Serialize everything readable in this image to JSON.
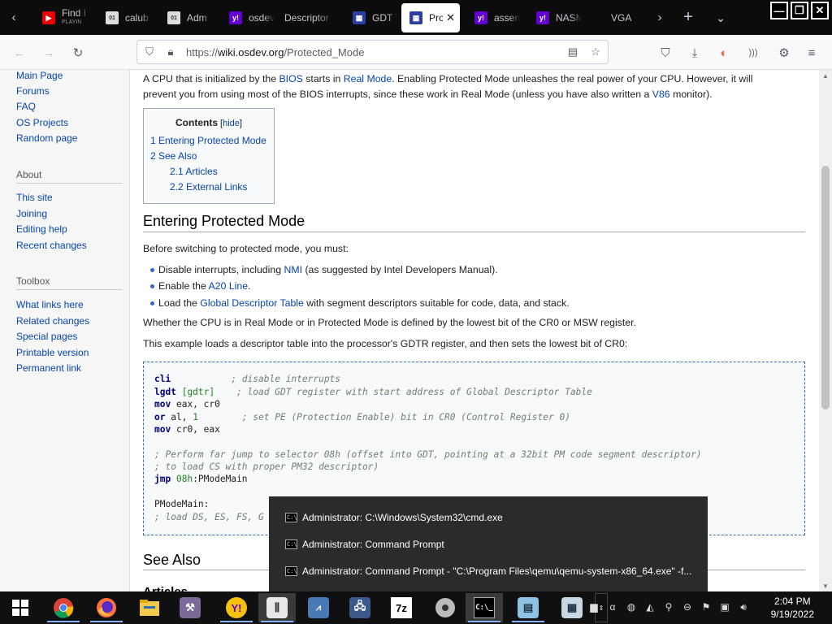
{
  "tabs": [
    {
      "title": "Find I",
      "subtitle": "PLAYIN",
      "icon": "youtube-icon"
    },
    {
      "title": "calub",
      "icon": "text-file-icon"
    },
    {
      "title": "Adm",
      "icon": "text-file-icon"
    },
    {
      "title": "osdev",
      "icon": "yahoo-icon"
    },
    {
      "title": "Descriptor",
      "icon": "blank-icon"
    },
    {
      "title": "GDT T",
      "icon": "osdev-icon"
    },
    {
      "title": "Pro",
      "icon": "osdev-icon",
      "active": true
    },
    {
      "title": "assem",
      "icon": "yahoo-icon"
    },
    {
      "title": "NASM",
      "icon": "yahoo-icon"
    },
    {
      "title": "VGA",
      "icon": "blank-icon"
    }
  ],
  "tab_close_glyph": "✕",
  "window": {
    "minimize": "—",
    "maximize": "❐",
    "close": "✕"
  },
  "url": {
    "scheme": "https://",
    "host": "wiki.osdev.org",
    "path": "/Protected_Mode"
  },
  "sidebar": {
    "nav": [
      "Main Page",
      "Forums",
      "FAQ",
      "OS Projects",
      "Random page"
    ],
    "about_heading": "About",
    "about": [
      "This site",
      "Joining",
      "Editing help",
      "Recent changes"
    ],
    "toolbox_heading": "Toolbox",
    "toolbox": [
      "What links here",
      "Related changes",
      "Special pages",
      "Printable version",
      "Permanent link"
    ]
  },
  "article": {
    "intro1": {
      "t1": "A CPU that is initialized by the ",
      "l1": "BIOS",
      "t2": " starts in ",
      "l2": "Real Mode",
      "t3": ". Enabling Protected Mode unleashes the real power of your CPU. However, it will"
    },
    "intro2": {
      "t1": "prevent you from using most of the BIOS interrupts, since these work in Real Mode (unless you have also written a ",
      "l1": "V86",
      "t2": " monitor)."
    },
    "toc": {
      "title": "Contents",
      "hide_open": " [",
      "hide": "hide",
      "hide_close": "]",
      "items": [
        "1 Entering Protected Mode",
        "2 See Also",
        "2.1 Articles",
        "2.2 External Links"
      ]
    },
    "h_entering": "Entering Protected Mode",
    "before": "Before switching to protected mode, you must:",
    "b1": {
      "t1": "Disable interrupts, including ",
      "l1": "NMI",
      "t2": " (as suggested by Intel Developers Manual)."
    },
    "b2": {
      "t1": "Enable the ",
      "l1": "A20 Line",
      "t2": "."
    },
    "b3": {
      "t1": "Load the ",
      "l1": "Global Descriptor Table",
      "t2": " with segment descriptors suitable for code, data, and stack."
    },
    "whether": "Whether the CPU is in Real Mode or in Protected Mode is defined by the lowest bit of the CR0 or MSW register.",
    "example": "This example loads a descriptor table into the processor's GDTR register, and then sets the lowest bit of CR0:",
    "code": {
      "l1_kw": "cli",
      "l1_cm": "; disable interrupts",
      "l2_kw": "lgdt",
      "l2_arg": "[gdtr]",
      "l2_cm": "; load GDT register with start address of Global Descriptor Table",
      "l3_kw": "mov",
      "l3_arg": "eax, cr0",
      "l4_kw": "or",
      "l4_a": "al, ",
      "l4_n": "1",
      "l4_cm": "; set PE (Protection Enable) bit in CR0 (Control Register 0)",
      "l5_kw": "mov",
      "l5_arg": "cr0, eax",
      "l6_cm": "; Perform far jump to selector 08h (offset into GDT, pointing at a 32bit PM code segment descriptor)",
      "l7_cm": "; to load CS with proper PM32 descriptor)",
      "l8_kw": "jmp",
      "l8_n": "08h",
      "l8_arg": ":PModeMain",
      "l9": "PModeMain:",
      "l10_cm": "; load DS, ES, FS, G"
    },
    "h_see_also": "See Also",
    "h_articles": "Articles"
  },
  "taskbar_popup": [
    "Administrator: C:\\Windows\\System32\\cmd.exe",
    "Administrator: Command Prompt",
    "Administrator: Command Prompt - \"C:\\Program Files\\qemu\\qemu-system-x86_64.exe\" -f..."
  ],
  "taskbar": {
    "apps": [
      "chrome-icon",
      "firefox-icon",
      "file-explorer-icon",
      "tool-icon",
      "yahoo-messenger-icon",
      "equalizer-icon",
      "monitor-icon",
      "network-icon",
      "7zip-icon",
      "disc-icon",
      "cmd-icon",
      "notepad-icon",
      "calculator-icon"
    ],
    "zip_label": "7z",
    "time": "2:04 PM",
    "date": "9/19/2022"
  },
  "colors": {
    "link": "#0645ad",
    "tab_bar": "#0c0c0d",
    "taskbar": "#101010"
  }
}
